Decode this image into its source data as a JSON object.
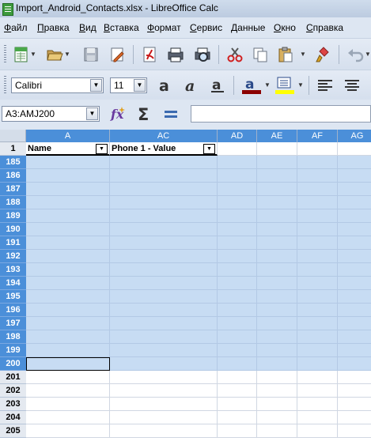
{
  "window": {
    "title": "Import_Android_Contacts.xlsx - LibreOffice Calc"
  },
  "menu": [
    {
      "label": "Файл",
      "u": "Ф",
      "rest": "айл"
    },
    {
      "label": "Правка",
      "u": "П",
      "rest": "равка"
    },
    {
      "label": "Вид",
      "u": "В",
      "rest": "ид"
    },
    {
      "label": "Вставка",
      "u": "В",
      "rest": "ставка"
    },
    {
      "label": "Формат",
      "u": "Ф",
      "rest": "ормат"
    },
    {
      "label": "Сервис",
      "u": "С",
      "rest": "ервис"
    },
    {
      "label": "Данные",
      "u": "Д",
      "rest": "анные"
    },
    {
      "label": "Окно",
      "u": "О",
      "rest": "кно"
    },
    {
      "label": "Справка",
      "u": "С",
      "rest": "правка"
    }
  ],
  "formatting": {
    "font_name": "Calibri",
    "font_size": "11"
  },
  "namebox": {
    "value": "A3:AMJ200"
  },
  "formula": {
    "value": ""
  },
  "columns": [
    "A",
    "AC",
    "AD",
    "AE",
    "AF",
    "AG"
  ],
  "header_row": {
    "number": "1",
    "cells": [
      "Name",
      "Phone 1 - Value"
    ]
  },
  "selected_rows": [
    "185",
    "186",
    "187",
    "188",
    "189",
    "190",
    "191",
    "192",
    "193",
    "194",
    "195",
    "196",
    "197",
    "198",
    "199",
    "200"
  ],
  "normal_rows": [
    "201",
    "202",
    "203",
    "204",
    "205"
  ],
  "colors": {
    "selection": "#c7dcf3",
    "header_selected": "#4b8fd9",
    "font_color_underline": "#8b0000",
    "highlight_underline": "#ffff00"
  },
  "icons": [
    "new-spreadsheet-icon",
    "open-folder-icon",
    "save-icon",
    "edit-file-icon",
    "export-pdf-icon",
    "print-icon",
    "print-preview-icon",
    "cut-icon",
    "copy-icon",
    "paste-icon",
    "clone-format-icon",
    "undo-icon",
    "bold-icon",
    "italic-icon",
    "underline-icon",
    "font-color-icon",
    "highlight-icon",
    "align-left-icon",
    "align-center-icon",
    "function-wizard-icon",
    "sum-icon",
    "formula-equals-icon"
  ]
}
